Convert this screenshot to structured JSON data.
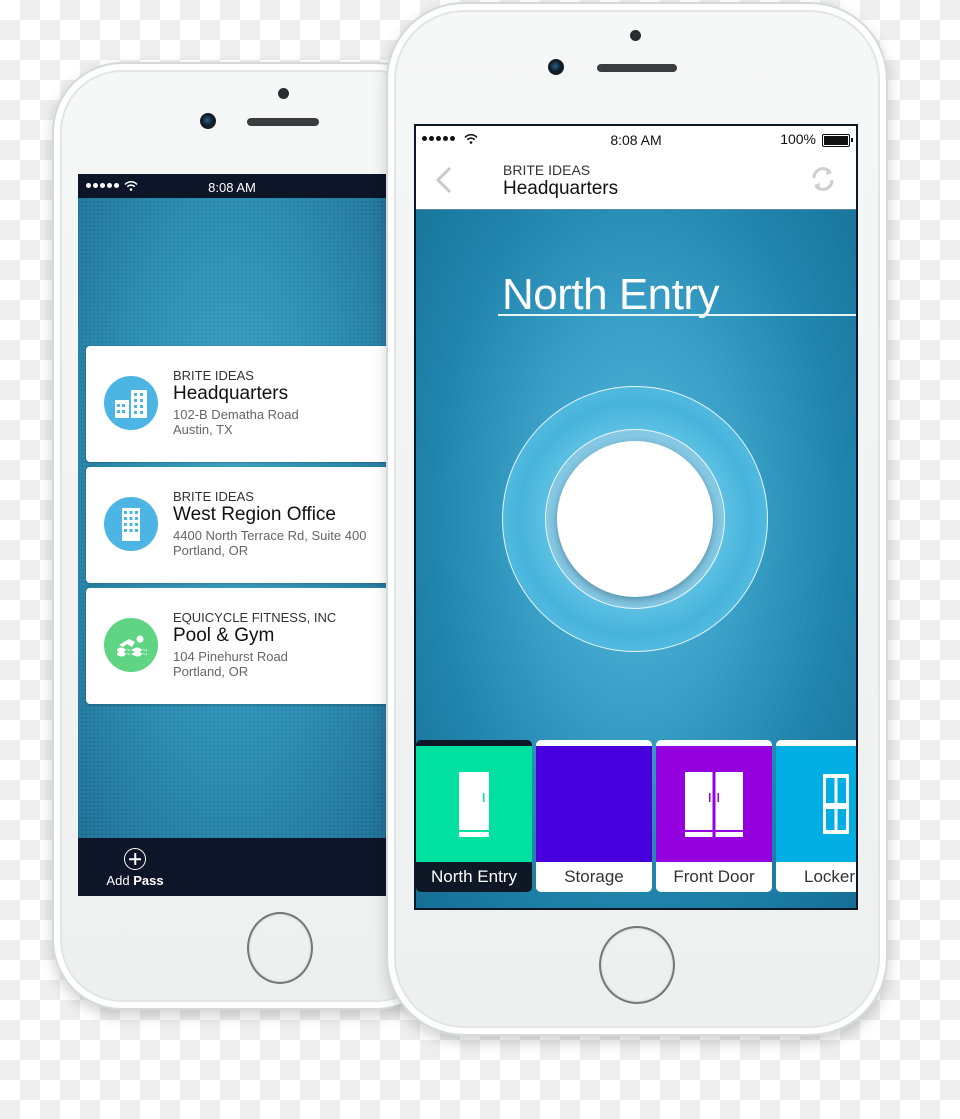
{
  "left_phone": {
    "status_bar": {
      "time": "8:08 AM"
    },
    "passes": [
      {
        "organization": "BRITE IDEAS",
        "name": "Headquarters",
        "address_line1": "102-B Dematha Road",
        "address_line2": "Austin, TX",
        "icon": "office-buildings-icon",
        "icon_color": "#4db5e3"
      },
      {
        "organization": "BRITE IDEAS",
        "name": "West Region Office",
        "address_line1": "4400 North Terrace Rd, Suite 400",
        "address_line2": "Portland, OR",
        "icon": "office-tower-icon",
        "icon_color": "#4db5e3"
      },
      {
        "organization": "EQUICYCLE FITNESS, INC",
        "name": "Pool & Gym",
        "address_line1": "104 Pinehurst Road",
        "address_line2": "Portland, OR",
        "icon": "swimmer-icon",
        "icon_color": "#5fd483"
      }
    ],
    "tab_bar": {
      "add_pass_prefix": "Add",
      "add_pass_bold": "Pass"
    }
  },
  "right_phone": {
    "status_bar": {
      "time": "8:08 AM",
      "battery": "100%"
    },
    "nav": {
      "organization": "BRITE IDEAS",
      "title": "Headquarters"
    },
    "door_title": "North Entry",
    "doors": [
      {
        "label": "North Entry",
        "color": "#00e0a0",
        "icon": "single-door-icon",
        "selected": true
      },
      {
        "label": "Storage",
        "color": "#4700dd",
        "icon": "",
        "selected": false
      },
      {
        "label": "Front Door",
        "color": "#9400de",
        "icon": "double-door-icon",
        "selected": false
      },
      {
        "label": "Locker",
        "color": "#00aee3",
        "icon": "paneled-door-icon",
        "selected": false
      }
    ]
  }
}
